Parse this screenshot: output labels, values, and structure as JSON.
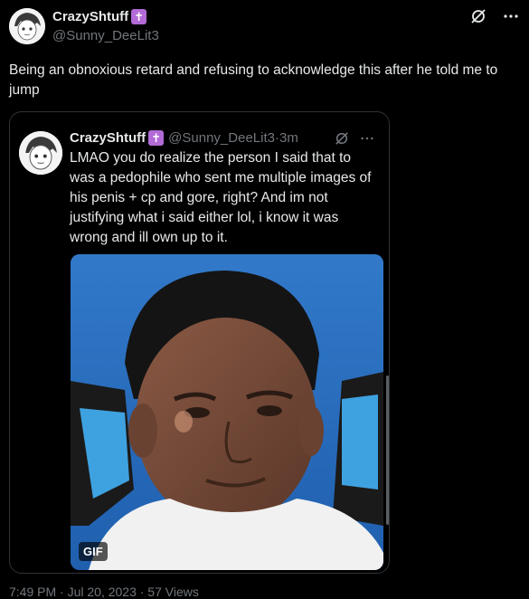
{
  "tweet": {
    "author_name": "CrazyShtuff",
    "author_badge": "✝",
    "author_handle": "@Sunny_DeeLit3",
    "text": "Being an obnoxious retard and refusing to acknowledge this after he told me to jump"
  },
  "quoted_tweet": {
    "author_name": "CrazyShtuff",
    "author_badge": "✝",
    "author_handle": "@Sunny_DeeLit3",
    "separator": "·",
    "time": "3m",
    "text": "LMAO you do realize the person I said that to was a pedophile who sent me multiple images of his penis + cp and gore, right? And im not justifying what i said either lol, i know it was wrong and ill own up to it.",
    "media_badge": "GIF"
  },
  "footer": {
    "partial_text": "7:49 PM · Jul 20, 2023 · 57 Views"
  },
  "icons": {
    "grok": "grok-icon",
    "more": "more-icon"
  },
  "colors": {
    "background": "#000000",
    "text": "#e7e9ea",
    "muted": "#71767b",
    "border": "#2f3336",
    "badge": "#b26ad6"
  }
}
